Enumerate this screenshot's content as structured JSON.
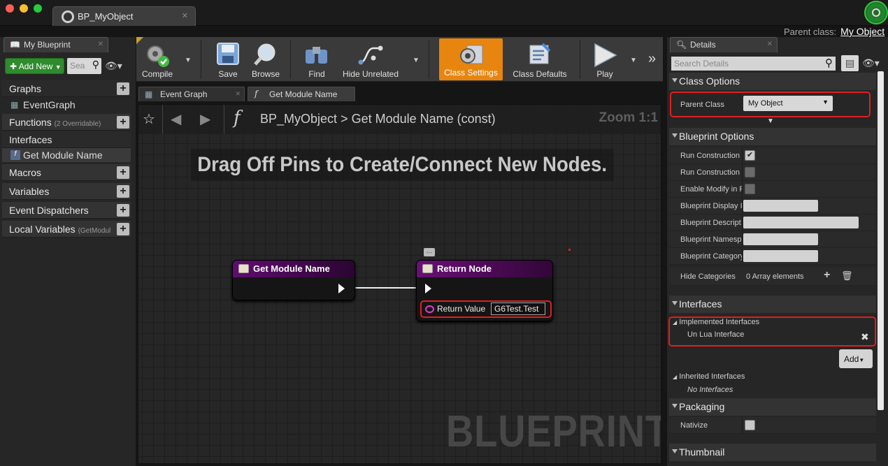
{
  "window": {
    "tab_title": "BP_MyObject",
    "parent_class_label": "Parent class:",
    "parent_class_value": "My Object"
  },
  "left_panel": {
    "tab": "My Blueprint",
    "add_new": "Add New",
    "search_placeholder": "Sea",
    "sections": {
      "graphs": "Graphs",
      "event_graph": "EventGraph",
      "functions": "Functions",
      "functions_sub": "(2 Overridable)",
      "interfaces": "Interfaces",
      "get_module_name": "Get Module Name",
      "macros": "Macros",
      "variables": "Variables",
      "event_dispatchers": "Event Dispatchers",
      "local_variables": "Local Variables",
      "local_variables_sub": "(GetModul"
    }
  },
  "toolbar": {
    "compile": "Compile",
    "save": "Save",
    "browse": "Browse",
    "find": "Find",
    "hide_unrelated": "Hide Unrelated",
    "class_settings": "Class Settings",
    "class_defaults": "Class Defaults",
    "play": "Play",
    "active_color": "#e8850f"
  },
  "graph_tabs": {
    "event_graph": "Event Graph",
    "get_module_name": "Get Module Name"
  },
  "graph": {
    "breadcrumb_root": "BP_MyObject",
    "breadcrumb_sep": ">",
    "breadcrumb_leaf": "Get Module Name (const)",
    "zoom": "Zoom 1:1",
    "hint": "Drag Off Pins to Create/Connect New Nodes.",
    "watermark": "BLUEPRINT",
    "node_entry": {
      "title": "Get Module Name",
      "header_color": "#5f0c6f"
    },
    "node_return": {
      "title": "Return Node",
      "pin_label": "Return Value",
      "pin_value": "G6Test.Test",
      "header_color": "#6a0f77"
    }
  },
  "details": {
    "tab": "Details",
    "search_placeholder": "Search Details",
    "class_options": "Class Options",
    "parent_class_key": "Parent Class",
    "parent_class_value": "My Object",
    "blueprint_options": "Blueprint Options",
    "rows": [
      {
        "key": "Run Construction",
        "checked": true
      },
      {
        "key": "Run Construction",
        "checked": false
      },
      {
        "key": "Enable Modify in F",
        "checked": false
      },
      {
        "key": "Blueprint Display I",
        "field": true
      },
      {
        "key": "Blueprint Descript",
        "field": true
      },
      {
        "key": "Blueprint Namesp",
        "field": true
      },
      {
        "key": "Blueprint Category",
        "field": true
      }
    ],
    "hide_categories_key": "Hide Categories",
    "hide_categories_value": "0 Array elements",
    "interfaces": "Interfaces",
    "implemented": "Implemented Interfaces",
    "implemented_item": "Un Lua Interface",
    "add": "Add",
    "inherited": "Inherited Interfaces",
    "no_interfaces": "No Interfaces",
    "packaging": "Packaging",
    "nativize": "Nativize",
    "thumbnail": "Thumbnail"
  }
}
